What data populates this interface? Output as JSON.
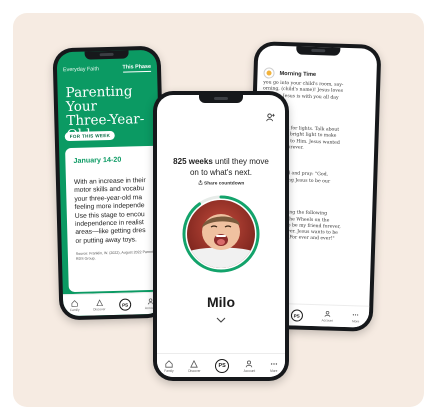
{
  "colors": {
    "background": "#f6ebe2",
    "brand_green": "#0b9a63",
    "ring_green": "#13a36b"
  },
  "left_phone": {
    "tabs": [
      "Everyday Faith",
      "This Phase"
    ],
    "title_lines": [
      "Parenting Your",
      "Three-Year-Old"
    ],
    "week_label": "FOR THIS WEEK",
    "date_range": "January 14-20",
    "body_lines": [
      "With an increase in their",
      "motor skills and vocabu",
      "your three-year-old ma",
      "feeling more independe",
      "Use this stage to encou",
      "independence in realist",
      "areas—like getting dres",
      "or putting away toys."
    ],
    "source_lines": [
      "Source: Franklin, W. (2022), August 2022 Parents app",
      "RDS Group."
    ]
  },
  "right_phone": {
    "sections": [
      {
        "title": "Morning Time",
        "icon": "sun-icon",
        "lines": [
          "you go into your child's room, say-",
          "orning, (child's name)! Jesus loves",
          "o much. Jesus is with you all day",
          "ever.\""
        ]
      },
      {
        "title": "ive Time",
        "lines": [
          "the go, look for lights. Talk about",
          "used a very bright light to make",
          "d and listen to Him. Jesus wanted",
          "His friend forever."
        ]
      },
      {
        "title": "ddle Time",
        "lines": [
          "th your child and pray: \"God,",
          "ou for sending Jesus to be our",
          "ever.\""
        ]
      },
      {
        "title": "th Time",
        "lines": [
          "your child, sing the following",
          "he tune of \"The Wheels on the",
          "esus wants to be my friend forever,",
          "forever, forever. Jesus wants to be",
          "iend forever. For ever and ever!\""
        ]
      }
    ]
  },
  "center_phone": {
    "weeks_count": "825 weeks",
    "weeks_rest_1": "until they move",
    "weeks_rest_2": "on to what's next.",
    "share_label": "Share countdown",
    "child_name": "Milo",
    "progress_fraction": 0.9
  },
  "bottom_nav": {
    "items": [
      {
        "label": "Family",
        "icon": "home-icon"
      },
      {
        "label": "Discover",
        "icon": "compass-icon"
      },
      {
        "label": "PS",
        "icon": "parent-cue-logo"
      },
      {
        "label": "Account",
        "icon": "person-icon"
      },
      {
        "label": "More",
        "icon": "more-icon"
      }
    ]
  }
}
